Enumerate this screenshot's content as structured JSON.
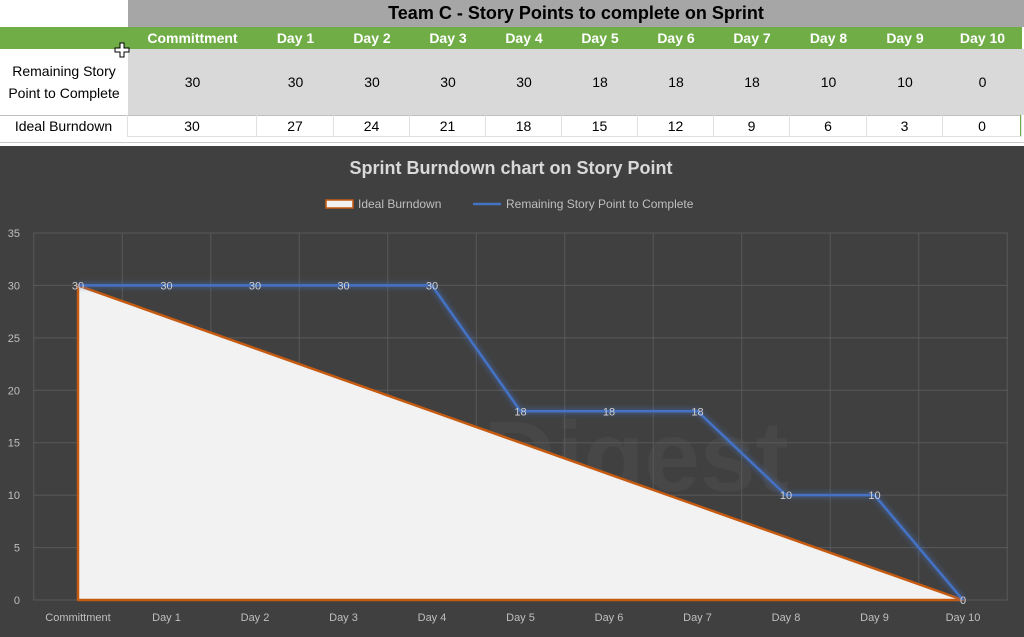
{
  "sheet": {
    "title": "Team C - Story Points to complete on Sprint",
    "columns": [
      "Committment",
      "Day 1",
      "Day 2",
      "Day 3",
      "Day 4",
      "Day 5",
      "Day 6",
      "Day 7",
      "Day 8",
      "Day 9",
      "Day 10"
    ],
    "rows": [
      {
        "label": "Remaining Story Point to Complete",
        "values": [
          "30",
          "30",
          "30",
          "30",
          "30",
          "18",
          "18",
          "18",
          "10",
          "10",
          "0"
        ]
      },
      {
        "label": "Ideal Burndown",
        "values": [
          "30",
          "27",
          "24",
          "21",
          "18",
          "15",
          "12",
          "9",
          "6",
          "3",
          "0"
        ]
      }
    ]
  },
  "chart_data": {
    "type": "line",
    "title": "Sprint Burndown chart on Story Point",
    "categories": [
      "Committment",
      "Day 1",
      "Day 2",
      "Day 3",
      "Day 4",
      "Day 5",
      "Day 6",
      "Day 7",
      "Day 8",
      "Day 9",
      "Day 10"
    ],
    "series": [
      {
        "name": "Ideal Burndown",
        "kind": "area",
        "values": [
          30,
          27,
          24,
          21,
          18,
          15,
          12,
          9,
          6,
          3,
          0
        ],
        "color": "#f2f2f2",
        "outline": "#c55a11"
      },
      {
        "name": "Remaining Story Point to Complete",
        "kind": "line",
        "values": [
          30,
          30,
          30,
          30,
          30,
          18,
          18,
          18,
          10,
          10,
          0
        ],
        "color": "#4472c4",
        "data_labels": true
      }
    ],
    "ylim": [
      0,
      35
    ],
    "yticks": [
      "0",
      "5",
      "10",
      "15",
      "20",
      "25",
      "30",
      "35"
    ],
    "grid": true,
    "legend": "top",
    "background": "#404040",
    "watermark": "Agile Digest"
  }
}
